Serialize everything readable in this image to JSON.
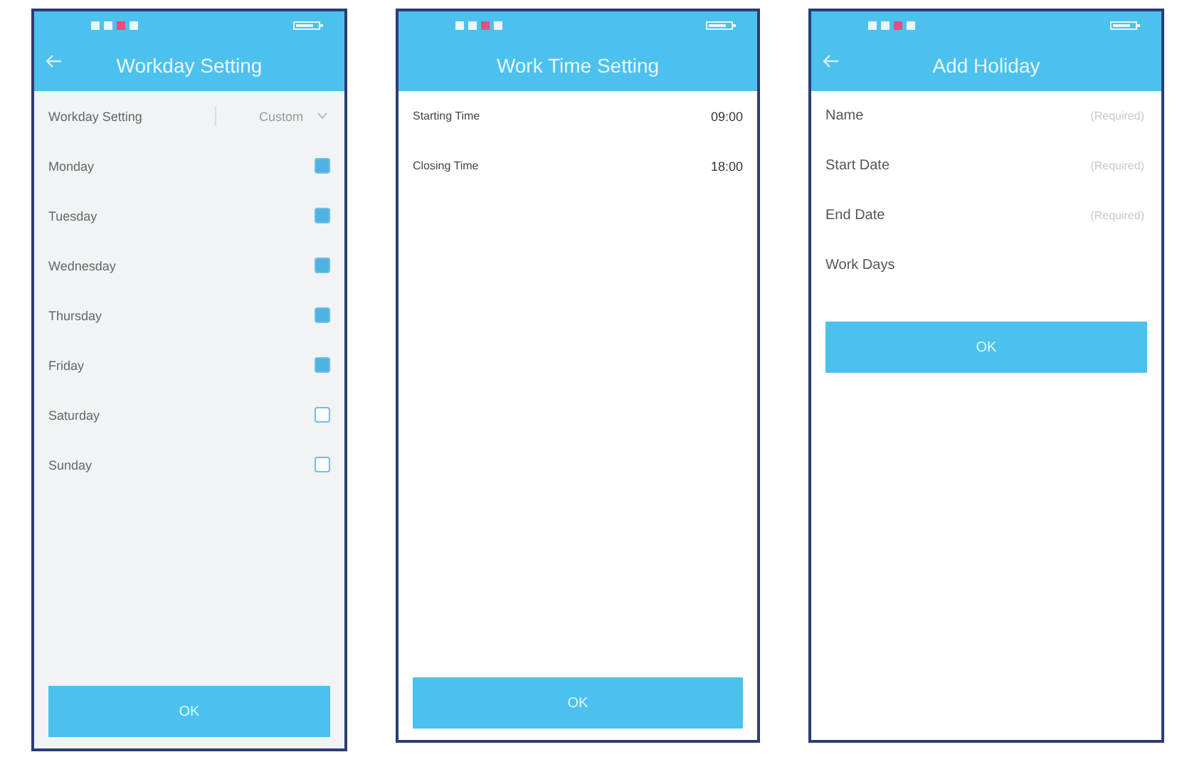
{
  "screens": [
    {
      "kind": "workday",
      "title": "Workday Setting",
      "mode_label": "Workday Setting",
      "mode_value": "Custom",
      "days": [
        {
          "label": "Monday",
          "checked": true
        },
        {
          "label": "Tuesday",
          "checked": true
        },
        {
          "label": "Wednesday",
          "checked": true
        },
        {
          "label": "Thursday",
          "checked": true
        },
        {
          "label": "Friday",
          "checked": true
        },
        {
          "label": "Saturday",
          "checked": false
        },
        {
          "label": "Sunday",
          "checked": false
        }
      ],
      "button": "OK"
    },
    {
      "kind": "worktime",
      "title": "Work Time Setting",
      "rows": [
        {
          "label": "Starting Time",
          "value": "09:00"
        },
        {
          "label": "Closing Time",
          "value": "18:00"
        }
      ],
      "button": "OK"
    },
    {
      "kind": "holiday",
      "title": "Add Holiday",
      "rows": [
        {
          "label": "Name",
          "placeholder": "(Required)"
        },
        {
          "label": "Start Date",
          "placeholder": "(Required)"
        },
        {
          "label": "End Date",
          "placeholder": "(Required)"
        },
        {
          "label": "Work Days"
        }
      ],
      "button": "OK"
    }
  ]
}
